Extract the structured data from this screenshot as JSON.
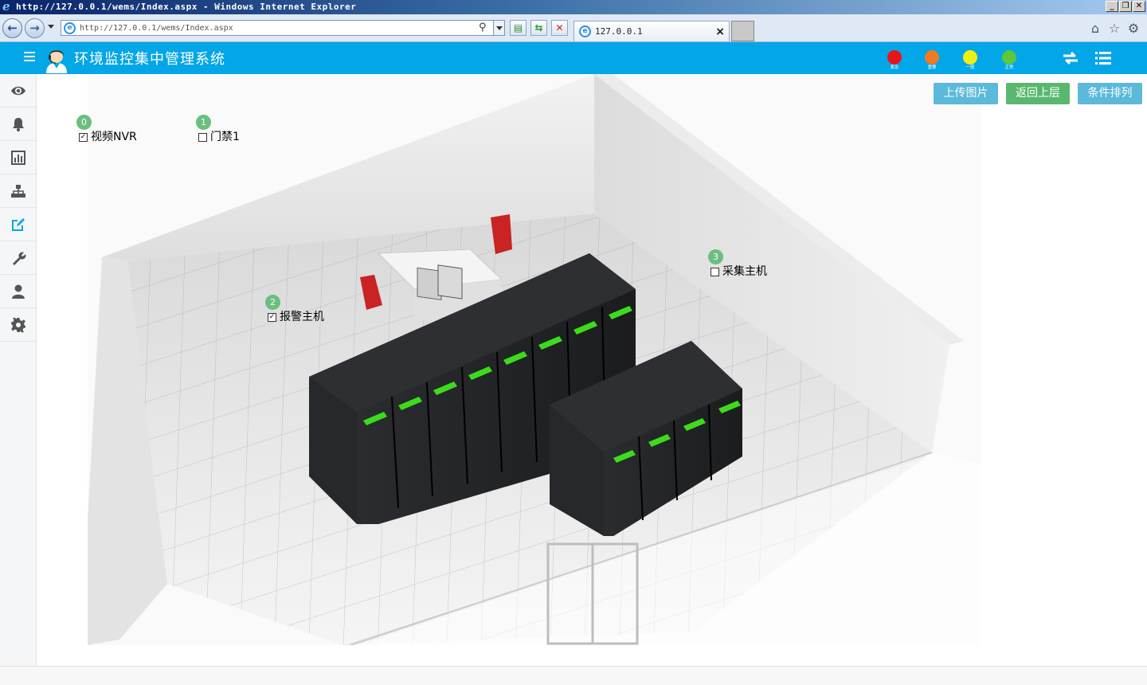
{
  "window": {
    "title": "http://127.0.0.1/wems/Index.aspx - Windows Internet Explorer",
    "minimize_glyph": "_",
    "restore_glyph": "❐",
    "close_glyph": "✕"
  },
  "browser": {
    "address": "http://127.0.0.1/wems/Index.aspx",
    "tab_label": "127.0.0.1",
    "tab_close": "×",
    "icons": [
      "back-icon",
      "forward-icon",
      "compat-view-icon",
      "refresh-icon",
      "stop-icon",
      "home-icon",
      "favorites-icon",
      "tools-icon"
    ]
  },
  "header": {
    "title": "环境监控集中管理系统",
    "status_lights": [
      {
        "label": "紧急",
        "color": "#e8141b"
      },
      {
        "label": "重要",
        "color": "#f07a22"
      },
      {
        "label": "一般",
        "color": "#f2ee10"
      },
      {
        "label": "正常",
        "color": "#5cc83a"
      }
    ],
    "icons": [
      "refresh-icon",
      "list-icon"
    ]
  },
  "sidebar": {
    "items": [
      {
        "icon": "eye-icon"
      },
      {
        "icon": "bell-icon"
      },
      {
        "icon": "bar-chart-icon"
      },
      {
        "icon": "sitemap-icon"
      },
      {
        "icon": "edit-icon",
        "active": true
      },
      {
        "icon": "wrench-icon"
      },
      {
        "icon": "user-icon"
      },
      {
        "icon": "gear-icon"
      }
    ]
  },
  "toolbar": {
    "upload_label": "上传图片",
    "back_label": "返回上层",
    "sort_label": "条件排列"
  },
  "devices": [
    {
      "index": "0",
      "name": "视频NVR",
      "checked": true
    },
    {
      "index": "1",
      "name": "门禁1",
      "checked": false
    },
    {
      "index": "2",
      "name": "报警主机",
      "checked": true
    },
    {
      "index": "3",
      "name": "采集主机",
      "checked": false
    }
  ],
  "colors": {
    "header_bg": "#03a6e7",
    "btn_blue": "#5bb9d9",
    "btn_green": "#59b86f",
    "badge_green": "#6abf7f",
    "active_icon": "#03a6e7"
  }
}
